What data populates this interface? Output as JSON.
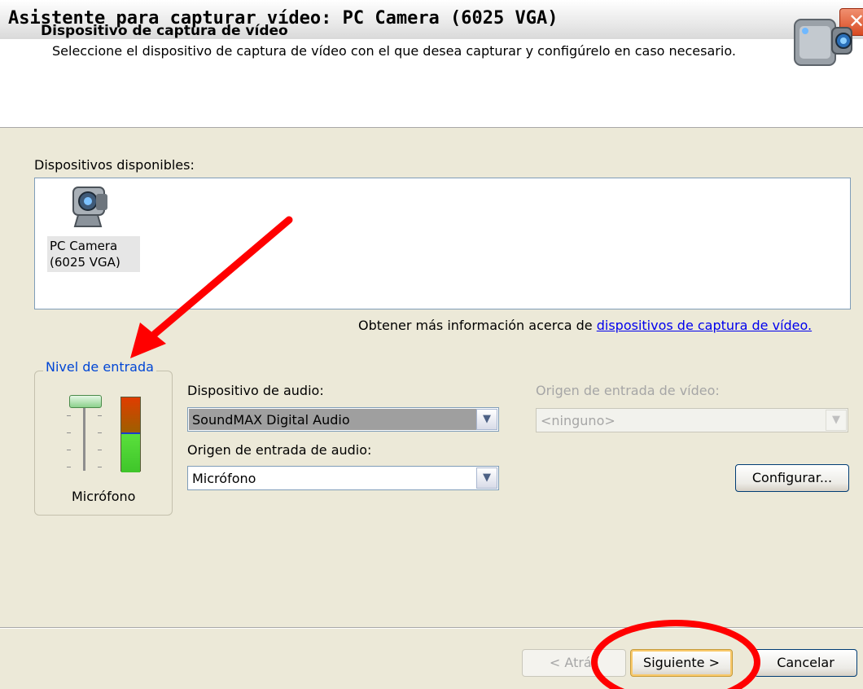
{
  "window": {
    "title": "Asistente para capturar vídeo: PC Camera (6025 VGA)",
    "close_label": "✕"
  },
  "header": {
    "title": "Dispositivo de captura de vídeo",
    "description": "Seleccione el dispositivo de captura de vídeo con el que desea capturar y configúrelo en caso necesario.",
    "icon": "camcorder-icon"
  },
  "devices": {
    "label": "Dispositivos disponibles:",
    "items": [
      {
        "name": "PC Camera (6025 VGA)",
        "icon": "webcam-icon"
      }
    ]
  },
  "more_info": {
    "prefix": "Obtener más información acerca de ",
    "link": "dispositivos de captura de vídeo."
  },
  "input_level": {
    "title": "Nivel de entrada",
    "source_label": "Micrófono",
    "level": 0.5
  },
  "audio": {
    "device_label": "Dispositivo de audio:",
    "device_value": "SoundMAX Digital Audio",
    "input_label": "Origen de entrada de audio:",
    "input_value": "Micrófono"
  },
  "video": {
    "input_label": "Origen de entrada de vídeo:",
    "input_value": "<ninguno>"
  },
  "buttons": {
    "configure": "Configurar...",
    "back": "< Atrás",
    "next": "Siguiente >",
    "cancel": "Cancelar"
  },
  "colors": {
    "annotation": "#ff0000",
    "link": "#0000ee",
    "group_title": "#0046d5"
  }
}
